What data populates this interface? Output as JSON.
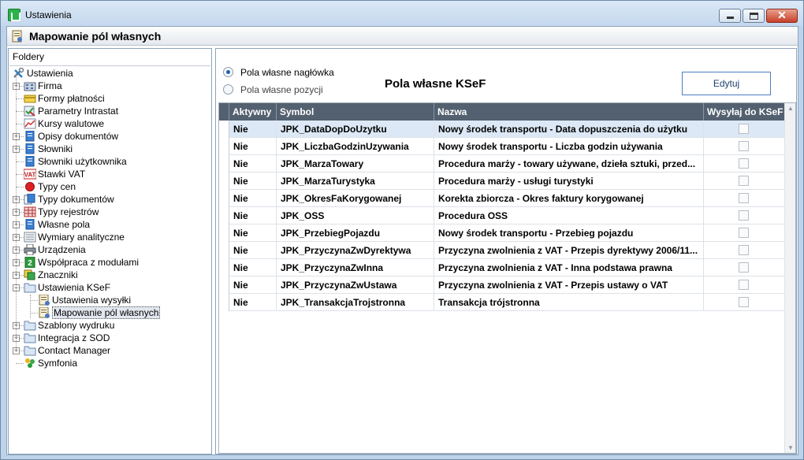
{
  "window": {
    "title": "Ustawienia"
  },
  "header": {
    "title": "Mapowanie pól własnych"
  },
  "left": {
    "folders_label": "Foldery",
    "tree": [
      {
        "label": "Ustawienia",
        "level": 0,
        "expander": "none",
        "icon": "tools-icon"
      },
      {
        "label": "Firma",
        "level": 1,
        "expander": "plus",
        "icon": "building-icon"
      },
      {
        "label": "Formy płatności",
        "level": 1,
        "expander": "none",
        "icon": "money-icon"
      },
      {
        "label": "Parametry Intrastat",
        "level": 1,
        "expander": "none",
        "icon": "intrastat-icon"
      },
      {
        "label": "Kursy walutowe",
        "level": 1,
        "expander": "none",
        "icon": "chart-icon"
      },
      {
        "label": "Opisy dokumentów",
        "level": 1,
        "expander": "plus",
        "icon": "doc-icon"
      },
      {
        "label": "Słowniki",
        "level": 1,
        "expander": "plus",
        "icon": "doc-icon"
      },
      {
        "label": "Słowniki użytkownika",
        "level": 1,
        "expander": "none",
        "icon": "doc-icon"
      },
      {
        "label": "Stawki VAT",
        "level": 1,
        "expander": "none",
        "icon": "vat-icon"
      },
      {
        "label": "Typy cen",
        "level": 1,
        "expander": "none",
        "icon": "red-dot-icon"
      },
      {
        "label": "Typy dokumentów",
        "level": 1,
        "expander": "plus",
        "icon": "docs-icon"
      },
      {
        "label": "Typy rejestrów",
        "level": 1,
        "expander": "plus",
        "icon": "register-icon"
      },
      {
        "label": "Własne pola",
        "level": 1,
        "expander": "plus",
        "icon": "doc-icon"
      },
      {
        "label": "Wymiary analityczne",
        "level": 1,
        "expander": "plus",
        "icon": "dimensions-icon"
      },
      {
        "label": "Urządzenia",
        "level": 1,
        "expander": "plus",
        "icon": "printer-icon"
      },
      {
        "label": "Współpraca z modułami",
        "level": 1,
        "expander": "plus",
        "icon": "modules-icon"
      },
      {
        "label": "Znaczniki",
        "level": 1,
        "expander": "plus",
        "icon": "tags-icon"
      },
      {
        "label": "Ustawienia KSeF",
        "level": 1,
        "expander": "minus",
        "icon": "folder-icon"
      },
      {
        "label": "Ustawienia wysyłki",
        "level": 2,
        "expander": "none",
        "icon": "settings-doc-icon"
      },
      {
        "label": "Mapowanie pól własnych",
        "level": 2,
        "expander": "none",
        "icon": "settings-doc-icon",
        "selected": true
      },
      {
        "label": "Szablony wydruku",
        "level": 1,
        "expander": "plus",
        "icon": "folder-icon"
      },
      {
        "label": "Integracja z SOD",
        "level": 1,
        "expander": "plus",
        "icon": "folder-icon"
      },
      {
        "label": "Contact Manager",
        "level": 1,
        "expander": "plus",
        "icon": "folder-icon"
      },
      {
        "label": "Symfonia",
        "level": 1,
        "expander": "none",
        "icon": "symfonia-icon"
      }
    ]
  },
  "right": {
    "radio_header": "Pola własne nagłówka",
    "radio_position": "Pola własne pozycji",
    "title": "Pola własne KSeF",
    "edit_button": "Edytuj",
    "columns": [
      "Aktywny",
      "Symbol",
      "Nazwa",
      "Wysyłaj do KSeF"
    ],
    "rows": [
      {
        "active": "Nie",
        "symbol": "JPK_DataDopDoUzytku",
        "name": "Nowy środek transportu - Data dopuszczenia do użytku",
        "send": false
      },
      {
        "active": "Nie",
        "symbol": "JPK_LiczbaGodzinUzywania",
        "name": "Nowy środek transportu - Liczba godzin używania",
        "send": false
      },
      {
        "active": "Nie",
        "symbol": "JPK_MarzaTowary",
        "name": "Procedura marży - towary używane, dzieła sztuki, przed...",
        "send": false
      },
      {
        "active": "Nie",
        "symbol": "JPK_MarzaTurystyka",
        "name": "Procedura marży - usługi turystyki",
        "send": false
      },
      {
        "active": "Nie",
        "symbol": "JPK_OkresFaKorygowanej",
        "name": "Korekta zbiorcza - Okres faktury korygowanej",
        "send": false
      },
      {
        "active": "Nie",
        "symbol": "JPK_OSS",
        "name": "Procedura OSS",
        "send": false
      },
      {
        "active": "Nie",
        "symbol": "JPK_PrzebiegPojazdu",
        "name": "Nowy środek transportu - Przebieg pojazdu",
        "send": false
      },
      {
        "active": "Nie",
        "symbol": "JPK_PrzyczynaZwDyrektywa",
        "name": "Przyczyna zwolnienia z VAT - Przepis dyrektywy 2006/11...",
        "send": false
      },
      {
        "active": "Nie",
        "symbol": "JPK_PrzyczynaZwInna",
        "name": "Przyczyna zwolnienia z VAT - Inna podstawa prawna",
        "send": false
      },
      {
        "active": "Nie",
        "symbol": "JPK_PrzyczynaZwUstawa",
        "name": "Przyczyna zwolnienia z VAT - Przepis ustawy o VAT",
        "send": false
      },
      {
        "active": "Nie",
        "symbol": "JPK_TransakcjaTrojstronna",
        "name": "Transakcja trójstronna",
        "send": false
      }
    ]
  }
}
